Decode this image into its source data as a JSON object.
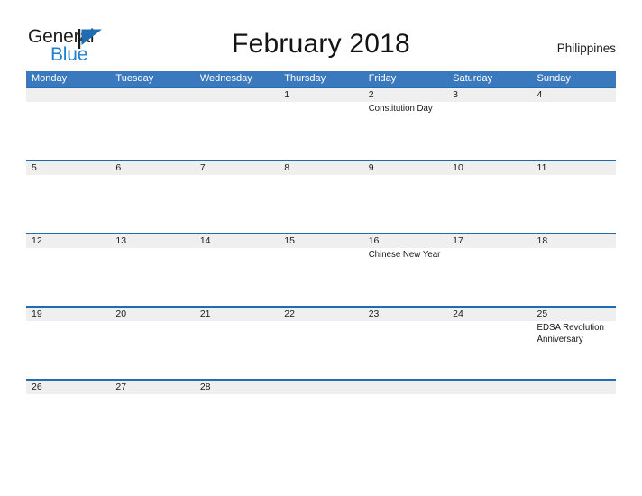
{
  "brand": {
    "name_part1": "General",
    "name_part2": "Blue",
    "flag_icon": "flag-triangle-icon",
    "accent_color": "#1f7fd0"
  },
  "header": {
    "title": "February 2018",
    "region": "Philippines"
  },
  "theme": {
    "header_bar_color": "#3a79bd",
    "week_rule_color": "#1f6cb0",
    "date_band_color": "#efefef",
    "text_color": "#1a1a1a"
  },
  "calendar": {
    "month": "February",
    "year": "2018",
    "day_headers": [
      "Monday",
      "Tuesday",
      "Wednesday",
      "Thursday",
      "Friday",
      "Saturday",
      "Sunday"
    ],
    "weeks": [
      [
        {
          "date": "",
          "events": []
        },
        {
          "date": "",
          "events": []
        },
        {
          "date": "",
          "events": []
        },
        {
          "date": "1",
          "events": []
        },
        {
          "date": "2",
          "events": [
            "Constitution Day"
          ]
        },
        {
          "date": "3",
          "events": []
        },
        {
          "date": "4",
          "events": []
        }
      ],
      [
        {
          "date": "5",
          "events": []
        },
        {
          "date": "6",
          "events": []
        },
        {
          "date": "7",
          "events": []
        },
        {
          "date": "8",
          "events": []
        },
        {
          "date": "9",
          "events": []
        },
        {
          "date": "10",
          "events": []
        },
        {
          "date": "11",
          "events": []
        }
      ],
      [
        {
          "date": "12",
          "events": []
        },
        {
          "date": "13",
          "events": []
        },
        {
          "date": "14",
          "events": []
        },
        {
          "date": "15",
          "events": []
        },
        {
          "date": "16",
          "events": [
            "Chinese New Year"
          ]
        },
        {
          "date": "17",
          "events": []
        },
        {
          "date": "18",
          "events": []
        }
      ],
      [
        {
          "date": "19",
          "events": []
        },
        {
          "date": "20",
          "events": []
        },
        {
          "date": "21",
          "events": []
        },
        {
          "date": "22",
          "events": []
        },
        {
          "date": "23",
          "events": []
        },
        {
          "date": "24",
          "events": []
        },
        {
          "date": "25",
          "events": [
            "EDSA Revolution Anniversary"
          ]
        }
      ],
      [
        {
          "date": "26",
          "events": []
        },
        {
          "date": "27",
          "events": []
        },
        {
          "date": "28",
          "events": []
        },
        {
          "date": "",
          "events": []
        },
        {
          "date": "",
          "events": []
        },
        {
          "date": "",
          "events": []
        },
        {
          "date": "",
          "events": []
        }
      ]
    ]
  }
}
